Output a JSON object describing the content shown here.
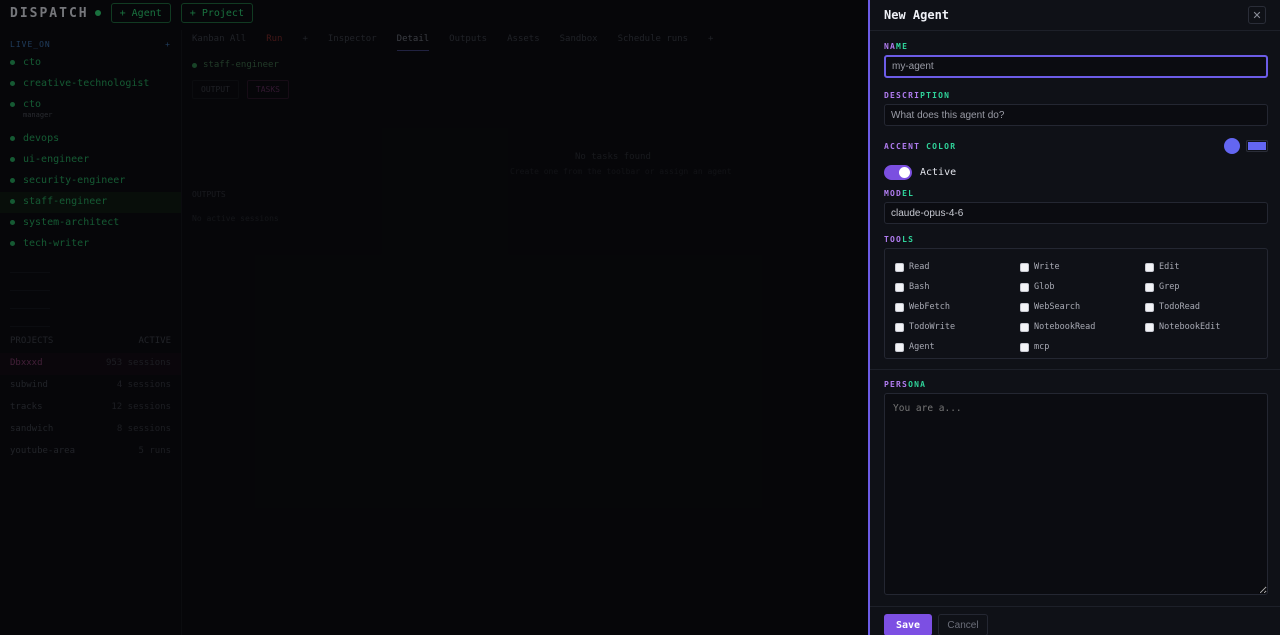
{
  "app": {
    "logo": "DISPATCH",
    "top_buttons": [
      "+ Agent",
      "+ Project"
    ],
    "sidebar_header": "LIVE_ON",
    "sidebar_header_action": "+",
    "agents": [
      {
        "name": "cto",
        "sub": ""
      },
      {
        "name": "creative-technologist",
        "sub": ""
      },
      {
        "name": "cto",
        "sub": "manager"
      },
      {
        "name": "devops",
        "sub": ""
      },
      {
        "name": "ui-engineer",
        "sub": ""
      },
      {
        "name": "security-engineer",
        "sub": ""
      },
      {
        "name": "staff-engineer",
        "sub": ""
      },
      {
        "name": "system-architect",
        "sub": ""
      },
      {
        "name": "tech-writer",
        "sub": ""
      }
    ],
    "projects_header": "PROJECTS",
    "projects_header_action": "ACTIVE",
    "projects": [
      {
        "name": "Dbxxxd",
        "count": "953 sessions"
      },
      {
        "name": "subwind",
        "count": "4 sessions"
      },
      {
        "name": "tracks",
        "count": "12 sessions"
      },
      {
        "name": "sandwich",
        "count": "8 sessions"
      },
      {
        "name": "youtube-area",
        "count": "5 runs"
      }
    ],
    "tabs": [
      "Kanban All",
      "Run",
      "+",
      "Inspector",
      "Detail",
      "Outputs",
      "Assets",
      "Sandbox",
      "Schedule runs",
      "+"
    ],
    "agent_chip": "staff-engineer",
    "subtabs": [
      "OUTPUT",
      "TASKS"
    ],
    "empty_title": "No tasks found",
    "empty_sub": "Create one from the toolbar or assign an agent",
    "section_label": "OUTPUTS",
    "section_empty": "No active sessions"
  },
  "panel": {
    "title": "New Agent",
    "close_glyph": "✕",
    "name_label": "NAME",
    "name_value": "",
    "name_placeholder": "my-agent",
    "description_label": "DESCRIPTION",
    "description_placeholder": "What does this agent do?",
    "accent_label": "ACCENT COLOR",
    "accent_color": "#6366f1",
    "active_label": "Active",
    "active_on": true,
    "model_label": "MODEL",
    "model_value": "claude-opus-4-6",
    "tools_label": "TOOLS",
    "tools": [
      "Read",
      "Write",
      "Edit",
      "Bash",
      "Glob",
      "Grep",
      "WebFetch",
      "WebSearch",
      "TodoRead",
      "TodoWrite",
      "NotebookRead",
      "NotebookEdit",
      "Agent",
      "mcp"
    ],
    "persona_label": "PERSONA",
    "persona_placeholder": "You are a...",
    "save_label": "Save",
    "cancel_label": "Cancel"
  }
}
